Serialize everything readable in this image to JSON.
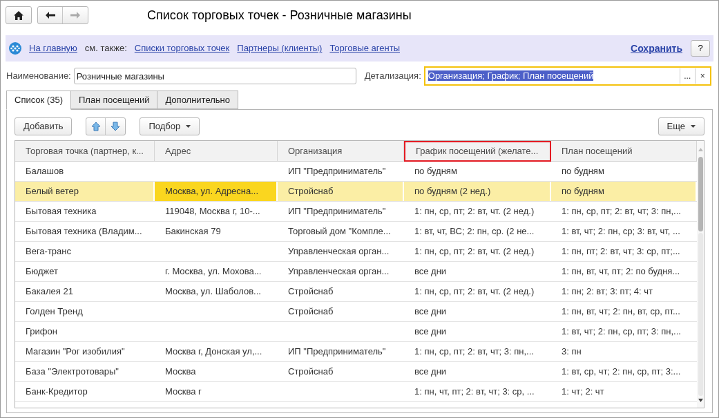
{
  "window": {
    "title": "Список торговых точек - Розничные магазины"
  },
  "navigation": {
    "home": "На главную",
    "see_also": "см. также:",
    "links": [
      "Списки торговых точек",
      "Партнеры (клиенты)",
      "Торговые агенты"
    ],
    "save": "Сохранить",
    "help": "?"
  },
  "fields": {
    "name_label": "Наименование:",
    "name_value": "Розничные магазины",
    "detail_label": "Детализация:",
    "detail_value": "Организация; График; План посещений",
    "detail_select_button": "...",
    "detail_clear_button": "×"
  },
  "tabs": [
    {
      "label": "Список (35)",
      "selected": true
    },
    {
      "label": "План посещений",
      "selected": false
    },
    {
      "label": "Дополнительно",
      "selected": false
    }
  ],
  "toolbar": {
    "add": "Добавить",
    "pick": "Подбор",
    "more": "Еще"
  },
  "table": {
    "columns": [
      {
        "label": "Торговая точка (партнер, к...",
        "highlighted": false,
        "current": false
      },
      {
        "label": "Адрес",
        "highlighted": false,
        "current": true
      },
      {
        "label": "Организация",
        "highlighted": false,
        "current": false
      },
      {
        "label": "График посещений (желате...",
        "highlighted": true,
        "current": false
      },
      {
        "label": "План посещений",
        "highlighted": false,
        "current": false
      }
    ],
    "rows": [
      {
        "selected": false,
        "cells": [
          "Балашов",
          "",
          "ИП \"Предприниматель\"",
          "по будням",
          "по будням"
        ]
      },
      {
        "selected": true,
        "cells": [
          "Белый ветер",
          "Москва, ул. Адресна...",
          "Стройснаб",
          "по будням (2 нед.)",
          "по будням"
        ]
      },
      {
        "selected": false,
        "cells": [
          "Бытовая техника",
          "119048, Москва г, 10-...",
          "ИП \"Предприниматель\"",
          "1: пн, ср, пт; 2: вт, чт. (2 нед.)",
          "1: пн, ср, пт; 2: вт, чт; 3: пн,..."
        ]
      },
      {
        "selected": false,
        "cells": [
          "Бытовая техника (Владим...",
          "Бакинская 79",
          "Торговый дом \"Компле...",
          "1: вт, чт, ВС; 2: пн, ср. (2 не...",
          "1: вт, чт; 2: пн, ср; 3: вт, чт, ..."
        ]
      },
      {
        "selected": false,
        "cells": [
          "Вега-транс",
          "",
          "Управленческая орган...",
          "1: пн, ср, пт; 2: вт, чт. (2 нед.)",
          "1: пн, пт; 2: вт, чт; 3: ср, пт;..."
        ]
      },
      {
        "selected": false,
        "cells": [
          "Бюджет",
          "г. Москва, ул. Мохова...",
          "Управленческая орган...",
          "все дни",
          "1: пн, вт, чт, пт; 2: по будня..."
        ]
      },
      {
        "selected": false,
        "cells": [
          "Бакалея 21",
          "Москва, ул. Шаболов...",
          "Стройснаб",
          "1: пн, ср, пт; 2: вт, чт. (2 нед.)",
          "1: пн; 2: вт; 3: пт; 4: чт"
        ]
      },
      {
        "selected": false,
        "cells": [
          "Голден Тренд",
          "",
          "Стройснаб",
          "все дни",
          "1: пн, вт, чт; 2: пн, вт, ср, пт..."
        ]
      },
      {
        "selected": false,
        "cells": [
          "Грифон",
          "",
          "",
          "все дни",
          "1: вт, чт; 2: пн, ср, пт; 3: пн,..."
        ]
      },
      {
        "selected": false,
        "cells": [
          "Магазин \"Рог изобилия\"",
          "Москва г, Донская ул,...",
          "ИП \"Предприниматель\"",
          "1: пн, ср, пт; 2: вт, чт; 3: пн,...",
          "3: пн"
        ]
      },
      {
        "selected": false,
        "cells": [
          "База \"Электротовары\"",
          "Москва",
          "Стройснаб",
          "все дни",
          "1: вт, ср, чт; 2: пн, ср, пт; 3:..."
        ]
      },
      {
        "selected": false,
        "cells": [
          "Банк-Кредитор",
          "Москва г",
          "",
          "1: пн, чт, пт; 2: вт, чт; 3: ср, ...",
          "1: чт; 2: чт"
        ]
      }
    ]
  }
}
